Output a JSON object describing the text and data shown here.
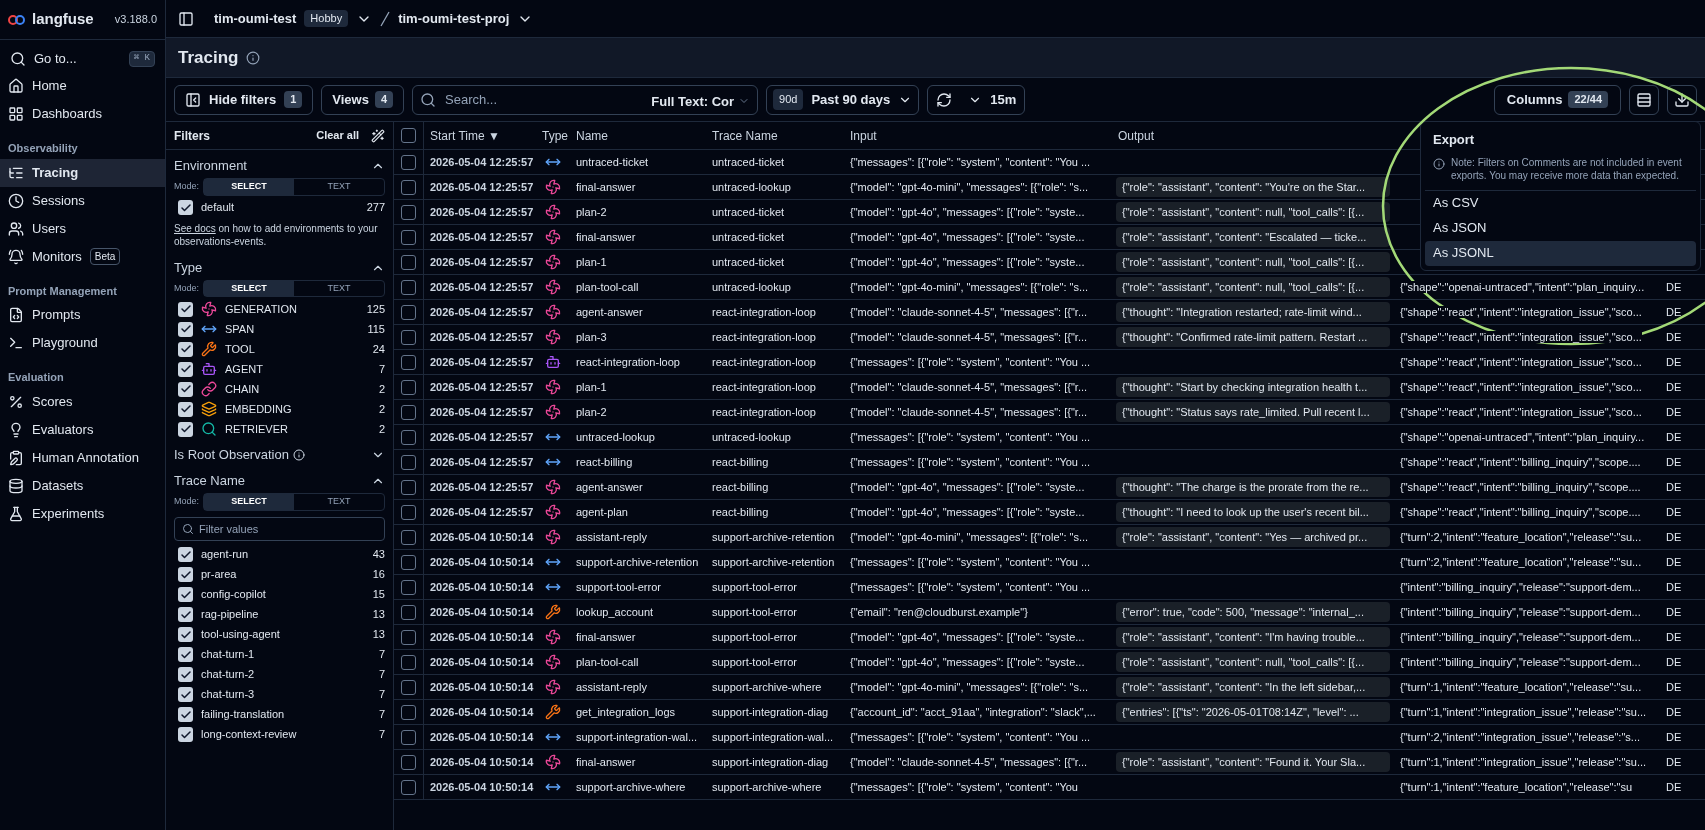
{
  "app": {
    "logo": "langfuse",
    "version": "v3.188.0"
  },
  "breadcrumb": {
    "org": "tim-oumi-test",
    "plan": "Hobby",
    "project": "tim-oumi-test-proj"
  },
  "sidebar": {
    "search": {
      "label": "Go to...",
      "shortcut": "⌘ K"
    },
    "sections": [
      {
        "items": [
          {
            "label": "Home",
            "selected": false
          },
          {
            "label": "Dashboards",
            "selected": false
          }
        ]
      },
      {
        "heading": "Observability",
        "items": [
          {
            "label": "Tracing",
            "selected": true
          },
          {
            "label": "Sessions",
            "selected": false
          },
          {
            "label": "Users",
            "selected": false
          },
          {
            "label": "Monitors",
            "badge": "Beta",
            "selected": false
          }
        ]
      },
      {
        "heading": "Prompt Management",
        "items": [
          {
            "label": "Prompts",
            "selected": false
          },
          {
            "label": "Playground",
            "selected": false
          }
        ]
      },
      {
        "heading": "Evaluation",
        "items": [
          {
            "label": "Scores",
            "selected": false
          },
          {
            "label": "Evaluators",
            "selected": false
          },
          {
            "label": "Human Annotation",
            "selected": false
          },
          {
            "label": "Datasets",
            "selected": false
          },
          {
            "label": "Experiments",
            "selected": false
          }
        ]
      }
    ]
  },
  "page": {
    "title": "Tracing"
  },
  "toolbar": {
    "hide_filters": {
      "label": "Hide filters",
      "count": "1"
    },
    "views": {
      "label": "Views",
      "count": "4"
    },
    "search": {
      "placeholder": "Search..."
    },
    "search_mode": "Full Text: Cor",
    "date_range": {
      "badge": "90d",
      "label": "Past 90 days"
    },
    "refresh": {
      "interval": "15m"
    },
    "columns": {
      "label": "Columns",
      "count": "22/44"
    }
  },
  "filters": {
    "title": "Filters",
    "clear": "Clear all",
    "sections": [
      {
        "title": "Environment",
        "expanded": true,
        "mode_label": "Mode:",
        "modes": [
          {
            "label": "SELECT",
            "selected": true
          },
          {
            "label": "TEXT",
            "selected": false
          }
        ],
        "options": [
          {
            "label": "default",
            "count": "277",
            "checked": true
          }
        ],
        "note": {
          "link": "See docs",
          "text": "on how to add environments to your observations-events."
        }
      },
      {
        "title": "Type",
        "expanded": true,
        "mode_label": "Mode:",
        "modes": [
          {
            "label": "SELECT",
            "selected": true
          },
          {
            "label": "TEXT",
            "selected": false
          }
        ],
        "options": [
          {
            "kind": "generation",
            "label": "GENERATION",
            "count": "125",
            "checked": true
          },
          {
            "kind": "span",
            "label": "SPAN",
            "count": "115",
            "checked": true
          },
          {
            "kind": "tool",
            "label": "TOOL",
            "count": "24",
            "checked": true
          },
          {
            "kind": "agent",
            "label": "AGENT",
            "count": "7",
            "checked": true
          },
          {
            "kind": "chain",
            "label": "CHAIN",
            "count": "2",
            "checked": true
          },
          {
            "kind": "embedding",
            "label": "EMBEDDING",
            "count": "2",
            "checked": true
          },
          {
            "kind": "retriever",
            "label": "RETRIEVER",
            "count": "2",
            "checked": true
          }
        ]
      },
      {
        "title": "Is Root Observation",
        "info": true,
        "expanded": false
      },
      {
        "title": "Trace Name",
        "expanded": true,
        "mode_label": "Mode:",
        "modes": [
          {
            "label": "SELECT",
            "selected": true
          },
          {
            "label": "TEXT",
            "selected": false
          }
        ],
        "search": {
          "placeholder": "Filter values"
        },
        "options": [
          {
            "label": "agent-run",
            "count": "43",
            "checked": true
          },
          {
            "label": "pr-area",
            "count": "16",
            "checked": true
          },
          {
            "label": "config-copilot",
            "count": "15",
            "checked": true
          },
          {
            "label": "rag-pipeline",
            "count": "13",
            "checked": true
          },
          {
            "label": "tool-using-agent",
            "count": "13",
            "checked": true
          },
          {
            "label": "chat-turn-1",
            "count": "7",
            "checked": true
          },
          {
            "label": "chat-turn-2",
            "count": "7",
            "checked": true
          },
          {
            "label": "chat-turn-3",
            "count": "7",
            "checked": true
          },
          {
            "label": "failing-translation",
            "count": "7",
            "checked": true
          },
          {
            "label": "long-context-review",
            "count": "7",
            "checked": true
          }
        ]
      }
    ]
  },
  "table": {
    "select_all": {
      "checked": false
    },
    "columns": [
      {
        "label": "Start Time",
        "sort": "▼"
      },
      {
        "label": "Type"
      },
      {
        "label": "Name"
      },
      {
        "label": "Trace Name"
      },
      {
        "label": "Input"
      },
      {
        "label": "Output"
      }
    ],
    "rows": [
      {
        "checked": false,
        "start_time": "2026-05-04 12:25:57",
        "kind": "span",
        "name": "untraced-ticket",
        "trace_name": "untraced-ticket",
        "input": "{\"messages\": [{\"role\": \"system\", \"content\": \"You ..."
      },
      {
        "checked": false,
        "start_time": "2026-05-04 12:25:57",
        "kind": "generation",
        "name": "final-answer",
        "trace_name": "untraced-lookup",
        "input": "{\"model\": \"gpt-4o-mini\", \"messages\": [{\"role\": \"s...",
        "output": "{\"role\": \"assistant\", \"content\": \"You're on the Star..."
      },
      {
        "checked": false,
        "start_time": "2026-05-04 12:25:57",
        "kind": "generation",
        "name": "plan-2",
        "trace_name": "untraced-ticket",
        "input": "{\"model\": \"gpt-4o\", \"messages\": [{\"role\": \"syste...",
        "output": "{\"role\": \"assistant\", \"content\": null, \"tool_calls\": [{..."
      },
      {
        "checked": false,
        "start_time": "2026-05-04 12:25:57",
        "kind": "generation",
        "name": "final-answer",
        "trace_name": "untraced-ticket",
        "input": "{\"model\": \"gpt-4o\", \"messages\": [{\"role\": \"syste...",
        "output": "{\"role\": \"assistant\", \"content\": \"Escalated — ticke..."
      },
      {
        "checked": false,
        "start_time": "2026-05-04 12:25:57",
        "kind": "generation",
        "name": "plan-1",
        "trace_name": "untraced-ticket",
        "input": "{\"model\": \"gpt-4o\", \"messages\": [{\"role\": \"syste...",
        "output": "{\"role\": \"assistant\", \"content\": null, \"tool_calls\": [{..."
      },
      {
        "checked": false,
        "start_time": "2026-05-04 12:25:57",
        "kind": "generation",
        "name": "plan-tool-call",
        "trace_name": "untraced-lookup",
        "input": "{\"model\": \"gpt-4o-mini\", \"messages\": [{\"role\": \"s...",
        "output": "{\"role\": \"assistant\", \"content\": null, \"tool_calls\": [{...",
        "column_7": "{\"shape\":\"openai-untraced\",\"intent\":\"plan_inquiry...",
        "column_8": "DE"
      },
      {
        "checked": false,
        "start_time": "2026-05-04 12:25:57",
        "kind": "generation",
        "name": "agent-answer",
        "trace_name": "react-integration-loop",
        "input": "{\"model\": \"claude-sonnet-4-5\", \"messages\": [{\"r...",
        "output": "{\"thought\": \"Integration restarted; rate-limit wind...",
        "column_7": "{\"shape\":\"react\",\"intent\":\"integration_issue\",\"sco...",
        "column_8": "DE"
      },
      {
        "checked": false,
        "start_time": "2026-05-04 12:25:57",
        "kind": "generation",
        "name": "plan-3",
        "trace_name": "react-integration-loop",
        "input": "{\"model\": \"claude-sonnet-4-5\", \"messages\": [{\"r...",
        "output": "{\"thought\": \"Confirmed rate-limit pattern. Restart ...",
        "column_7": "{\"shape\":\"react\",\"intent\":\"integration_issue\",\"sco...",
        "column_8": "DE"
      },
      {
        "checked": false,
        "start_time": "2026-05-04 12:25:57",
        "kind": "agent",
        "name": "react-integration-loop",
        "trace_name": "react-integration-loop",
        "input": "{\"messages\": [{\"role\": \"system\", \"content\": \"You ...",
        "column_7": "{\"shape\":\"react\",\"intent\":\"integration_issue\",\"sco...",
        "column_8": "DE"
      },
      {
        "checked": false,
        "start_time": "2026-05-04 12:25:57",
        "kind": "generation",
        "name": "plan-1",
        "trace_name": "react-integration-loop",
        "input": "{\"model\": \"claude-sonnet-4-5\", \"messages\": [{\"r...",
        "output": "{\"thought\": \"Start by checking integration health t...",
        "column_7": "{\"shape\":\"react\",\"intent\":\"integration_issue\",\"sco...",
        "column_8": "DE"
      },
      {
        "checked": false,
        "start_time": "2026-05-04 12:25:57",
        "kind": "generation",
        "name": "plan-2",
        "trace_name": "react-integration-loop",
        "input": "{\"model\": \"claude-sonnet-4-5\", \"messages\": [{\"r...",
        "output": "{\"thought\": \"Status says rate_limited. Pull recent l...",
        "column_7": "{\"shape\":\"react\",\"intent\":\"integration_issue\",\"sco...",
        "column_8": "DE"
      },
      {
        "checked": false,
        "start_time": "2026-05-04 12:25:57",
        "kind": "span",
        "name": "untraced-lookup",
        "trace_name": "untraced-lookup",
        "input": "{\"messages\": [{\"role\": \"system\", \"content\": \"You ...",
        "column_7": "{\"shape\":\"openai-untraced\",\"intent\":\"plan_inquiry...",
        "column_8": "DE"
      },
      {
        "checked": false,
        "start_time": "2026-05-04 12:25:57",
        "kind": "span",
        "name": "react-billing",
        "trace_name": "react-billing",
        "input": "{\"messages\": [{\"role\": \"system\", \"content\": \"You ...",
        "column_7": "{\"shape\":\"react\",\"intent\":\"billing_inquiry\",\"scope....",
        "column_8": "DE"
      },
      {
        "checked": false,
        "start_time": "2026-05-04 12:25:57",
        "kind": "generation",
        "name": "agent-answer",
        "trace_name": "react-billing",
        "input": "{\"model\": \"gpt-4o\", \"messages\": [{\"role\": \"syste...",
        "output": "{\"thought\": \"The charge is the prorate from the re...",
        "column_7": "{\"shape\":\"react\",\"intent\":\"billing_inquiry\",\"scope....",
        "column_8": "DE"
      },
      {
        "checked": false,
        "start_time": "2026-05-04 12:25:57",
        "kind": "generation",
        "name": "agent-plan",
        "trace_name": "react-billing",
        "input": "{\"model\": \"gpt-4o\", \"messages\": [{\"role\": \"syste...",
        "output": "{\"thought\": \"I need to look up the user's recent bil...",
        "column_7": "{\"shape\":\"react\",\"intent\":\"billing_inquiry\",\"scope....",
        "column_8": "DE"
      },
      {
        "checked": false,
        "start_time": "2026-05-04 10:50:14",
        "kind": "generation",
        "name": "assistant-reply",
        "trace_name": "support-archive-retention",
        "input": "{\"model\": \"gpt-4o-mini\", \"messages\": [{\"role\": \"s...",
        "output": "{\"role\": \"assistant\", \"content\": \"Yes — archived pr...",
        "column_7": "{\"turn\":2,\"intent\":\"feature_location\",\"release\":\"su...",
        "column_8": "DE"
      },
      {
        "checked": false,
        "start_time": "2026-05-04 10:50:14",
        "kind": "span",
        "name": "support-archive-retention",
        "trace_name": "support-archive-retention",
        "input": "{\"messages\": [{\"role\": \"system\", \"content\": \"You ...",
        "column_7": "{\"turn\":2,\"intent\":\"feature_location\",\"release\":\"su...",
        "column_8": "DE"
      },
      {
        "checked": false,
        "start_time": "2026-05-04 10:50:14",
        "kind": "span",
        "name": "support-tool-error",
        "trace_name": "support-tool-error",
        "input": "{\"messages\": [{\"role\": \"system\", \"content\": \"You ...",
        "column_7": "{\"intent\":\"billing_inquiry\",\"release\":\"support-dem...",
        "column_8": "DE"
      },
      {
        "checked": false,
        "start_time": "2026-05-04 10:50:14",
        "kind": "tool",
        "name": "lookup_account",
        "trace_name": "support-tool-error",
        "input": "{\"email\": \"ren@cloudburst.example\"}",
        "output": "{\"error\": true, \"code\": 500, \"message\": \"internal_...",
        "column_7": "{\"intent\":\"billing_inquiry\",\"release\":\"support-dem...",
        "column_8": "DE"
      },
      {
        "checked": false,
        "start_time": "2026-05-04 10:50:14",
        "kind": "generation",
        "name": "final-answer",
        "trace_name": "support-tool-error",
        "input": "{\"model\": \"gpt-4o\", \"messages\": [{\"role\": \"syste...",
        "output": "{\"role\": \"assistant\", \"content\": \"I'm having trouble...",
        "column_7": "{\"intent\":\"billing_inquiry\",\"release\":\"support-dem...",
        "column_8": "DE"
      },
      {
        "checked": false,
        "start_time": "2026-05-04 10:50:14",
        "kind": "generation",
        "name": "plan-tool-call",
        "trace_name": "support-tool-error",
        "input": "{\"model\": \"gpt-4o\", \"messages\": [{\"role\": \"syste...",
        "output": "{\"role\": \"assistant\", \"content\": null, \"tool_calls\": [{...",
        "column_7": "{\"intent\":\"billing_inquiry\",\"release\":\"support-dem...",
        "column_8": "DE"
      },
      {
        "checked": false,
        "start_time": "2026-05-04 10:50:14",
        "kind": "generation",
        "name": "assistant-reply",
        "trace_name": "support-archive-where",
        "input": "{\"model\": \"gpt-4o-mini\", \"messages\": [{\"role\": \"s...",
        "output": "{\"role\": \"assistant\", \"content\": \"In the left sidebar,...",
        "column_7": "{\"turn\":1,\"intent\":\"feature_location\",\"release\":\"su...",
        "column_8": "DE"
      },
      {
        "checked": false,
        "start_time": "2026-05-04 10:50:14",
        "kind": "tool",
        "name": "get_integration_logs",
        "trace_name": "support-integration-diag",
        "input": "{\"account_id\": \"acct_91aa\", \"integration\": \"slack\",...",
        "output": "{\"entries\": [{\"ts\": \"2026-05-01T08:14Z\", \"level\": ...",
        "column_7": "{\"turn\":1,\"intent\":\"integration_issue\",\"release\":\"su...",
        "column_8": "DE"
      },
      {
        "checked": false,
        "start_time": "2026-05-04 10:50:14",
        "kind": "span",
        "name": "support-integration-wal...",
        "trace_name": "support-integration-wal...",
        "input": "{\"messages\": [{\"role\": \"system\", \"content\": \"You ...",
        "column_7": "{\"turn\":2,\"intent\":\"integration_issue\",\"release\":\"s...",
        "column_8": "DE"
      },
      {
        "checked": false,
        "start_time": "2026-05-04 10:50:14",
        "kind": "generation",
        "name": "final-answer",
        "trace_name": "support-integration-diag",
        "input": "{\"model\": \"claude-sonnet-4-5\", \"messages\": [{\"r...",
        "output": "{\"role\": \"assistant\", \"content\": \"Found it. Your Sla...",
        "column_7": "{\"turn\":1,\"intent\":\"integration_issue\",\"release\":\"su...",
        "column_8": "DE"
      },
      {
        "checked": false,
        "start_time": "2026-05-04 10:50:14",
        "kind": "span",
        "name": "support-archive-where",
        "trace_name": "support-archive-where",
        "input": "{\"messages\": [{\"role\": \"system\", \"content\": \"You",
        "column_7": "{\"turn\":1,\"intent\":\"feature_location\",\"release\":\"su",
        "column_8": "DE"
      }
    ]
  },
  "export_menu": {
    "title": "Export",
    "note": "Note: Filters on Comments are not included in event exports. You may receive more data than expected.",
    "options": [
      {
        "label": "As CSV",
        "selected": false
      },
      {
        "label": "As JSON",
        "selected": false
      },
      {
        "label": "As JSONL",
        "selected": true
      }
    ]
  }
}
